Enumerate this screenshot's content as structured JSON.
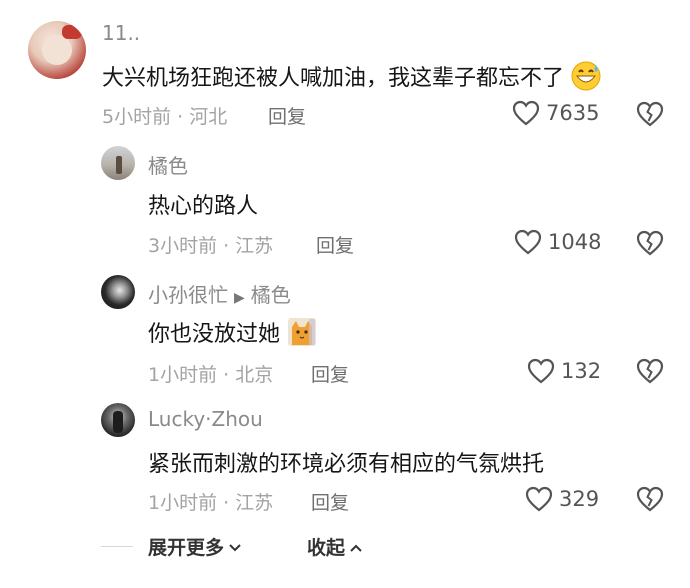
{
  "comments": [
    {
      "author": "11..",
      "text": "大兴机场狂跑还被人喊加油，我这辈子都忘不了",
      "emoji": "grinning-sweat-emoji",
      "time": "5小时前",
      "location": "河北",
      "reply_label": "回复",
      "likes": "7635"
    },
    {
      "author": "橘色",
      "text": "热心的路人",
      "time": "3小时前",
      "location": "江苏",
      "reply_label": "回复",
      "likes": "1048"
    },
    {
      "author": "小孙很忙",
      "reply_to": "橘色",
      "text": "你也没放过她",
      "emoji": "cat-sticker",
      "time": "1小时前",
      "location": "北京",
      "reply_label": "回复",
      "likes": "132"
    },
    {
      "author": "Lucky·Zhou",
      "text": "紧张而刺激的环境必须有相应的气氛烘托",
      "time": "1小时前",
      "location": "江苏",
      "reply_label": "回复",
      "likes": "329"
    }
  ],
  "footer": {
    "expand_label": "展开更多",
    "collapse_label": "收起"
  },
  "icons": {
    "like": "heart-outline-icon",
    "dislike": "broken-heart-icon",
    "expand": "chevron-down-icon",
    "collapse": "chevron-up-icon",
    "reply_arrow": "triangle-right-icon"
  },
  "meta_separator": " · "
}
